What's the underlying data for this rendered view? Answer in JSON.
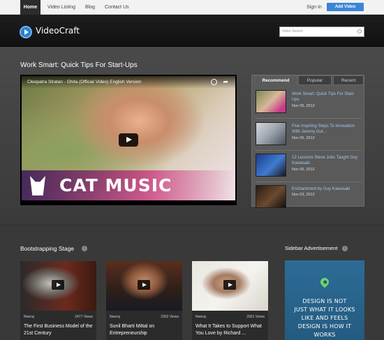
{
  "nav": {
    "items": [
      "Home",
      "Video Listing",
      "Blog",
      "Contact Us"
    ],
    "sign_in": "Sign In",
    "add_video": "Add Video"
  },
  "header": {
    "logo": "VideoCraft",
    "search_placeholder": "Video Search"
  },
  "featured": {
    "title": "Work Smart: Quick Tips For Start-Ups",
    "player_caption": "Cleopatra Stratan - Ghita (Official Video) English Version",
    "overlay_text": "CAT MUSIC"
  },
  "tabs": [
    "Recommend",
    "Popular",
    "Recent"
  ],
  "sidebar_videos": [
    {
      "title": "Work Smart: Quick Tips For Start-Ups",
      "date": "Nov 05, 2012"
    },
    {
      "title": "Five Inspiring Steps To Innovation With Jeremy Gut...",
      "date": "Nov 05, 2012"
    },
    {
      "title": "12 Lessons Steve Jobs Taught Guy Kawasaki",
      "date": "Nov 05, 2012"
    },
    {
      "title": "Enchantment by Guy Kawasaki",
      "date": "Nov 03, 2012"
    }
  ],
  "section": {
    "title": "Bootstrapping Stage",
    "info": "i"
  },
  "cards": [
    {
      "author": "Neeraj",
      "views": "2477 Views",
      "title": "The First Business Model of the 21st Century"
    },
    {
      "author": "Neeraj",
      "views": "2302 Views",
      "title": "Sunil Bharti Mittal on Entrepreneurship"
    },
    {
      "author": "Neeraj",
      "views": "2931 Views",
      "title": "What It Takes to Support What You Love by Richard ..."
    }
  ],
  "ad": {
    "title": "Sidebar Advertisement",
    "info": "i",
    "line1": "DESIGN IS NOT",
    "line2": "JUST WHAT IT LOOKS",
    "line3": "LIKE AND FEELS",
    "line4": "DESIGN IS HOW IT",
    "line5": "WORKS"
  },
  "colors": {
    "accent": "#3a86d6",
    "link": "#9cc8ee",
    "ad_bg": "#2d6c96"
  }
}
